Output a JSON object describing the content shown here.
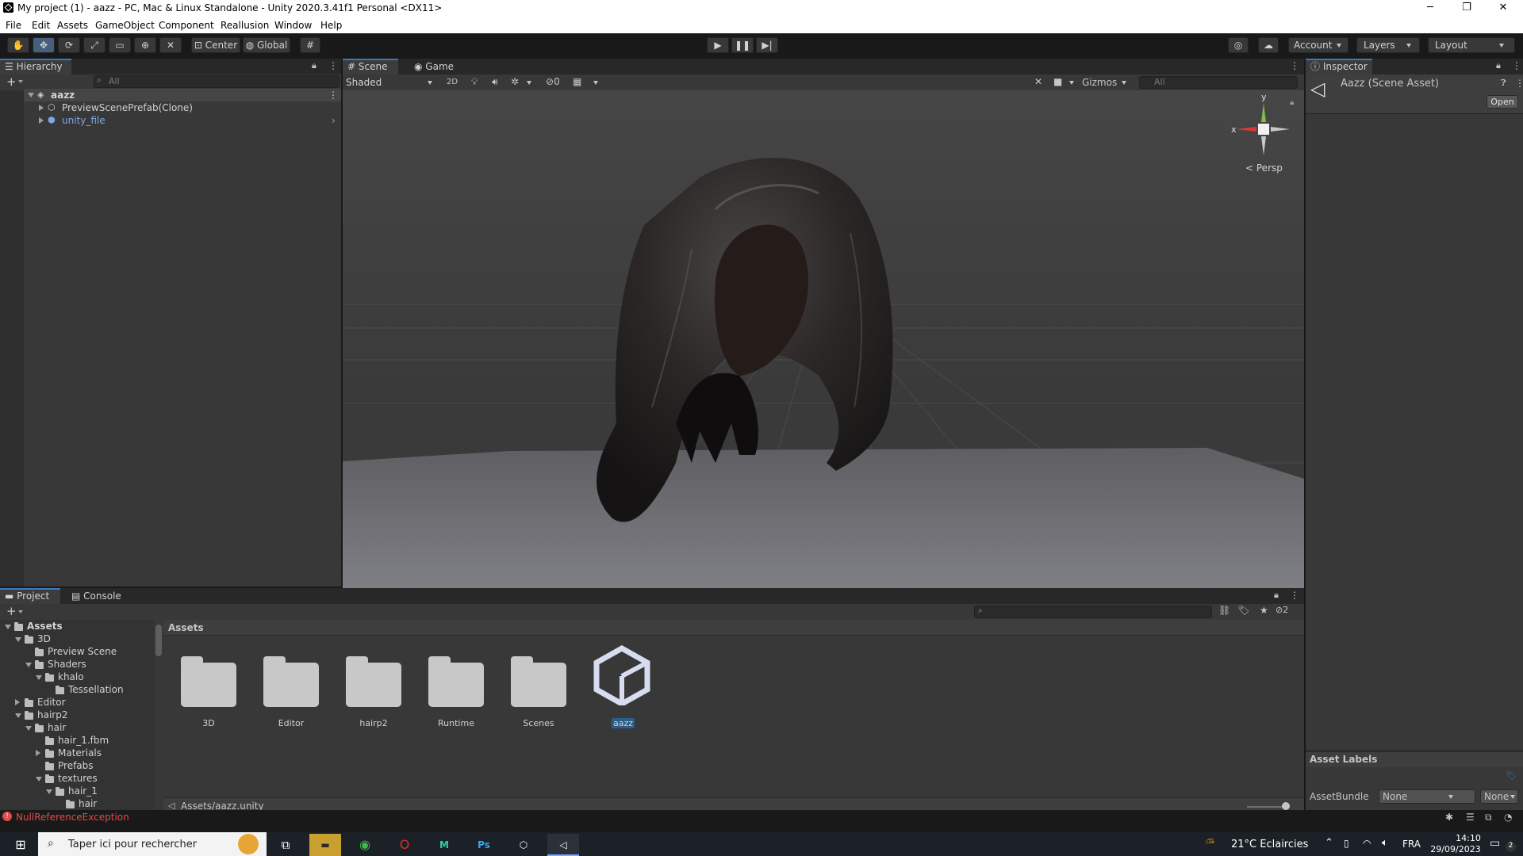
{
  "window": {
    "title": "My project (1) - aazz - PC, Mac & Linux Standalone - Unity 2020.3.41f1 Personal <DX11>",
    "minimize": "─",
    "restore": "❐",
    "close": "✕"
  },
  "menu": [
    "File",
    "Edit",
    "Assets",
    "GameObject",
    "Component",
    "Reallusion",
    "Window",
    "Help"
  ],
  "toolbar": {
    "center_label": "Center",
    "global_label": "Global",
    "account_label": "Account",
    "layers_label": "Layers",
    "layout_label": "Layout"
  },
  "hierarchy": {
    "tab_label": "Hierarchy",
    "search_placeholder": "All",
    "scene_name": "aazz",
    "items": [
      "PreviewScenePrefab(Clone)",
      "unity_file"
    ]
  },
  "scene": {
    "tab_scene": "Scene",
    "tab_game": "Game",
    "shading_mode": "Shaded",
    "mode_2d": "2D",
    "hidden_count": "0",
    "gizmos_label": "Gizmos",
    "search_placeholder": "All",
    "axis_y": "y",
    "axis_x": "x",
    "projection_label": "Persp"
  },
  "inspector": {
    "tab_label": "Inspector",
    "asset_title": "Aazz (Scene Asset)",
    "open_button": "Open",
    "asset_labels_title": "Asset Labels",
    "assetbundle_label": "AssetBundle",
    "assetbundle_value": "None",
    "variant_value": "None"
  },
  "project": {
    "tab_project": "Project",
    "tab_console": "Console",
    "hidden_count": "2",
    "tree": [
      {
        "label": "Assets",
        "depth": 0,
        "expanded": true,
        "bold": true
      },
      {
        "label": "3D",
        "depth": 1,
        "expanded": true
      },
      {
        "label": "Preview Scene",
        "depth": 2,
        "leaf": true
      },
      {
        "label": "Shaders",
        "depth": 2,
        "expanded": true
      },
      {
        "label": "khalo",
        "depth": 3,
        "expanded": true
      },
      {
        "label": "Tessellation",
        "depth": 4,
        "leaf": true
      },
      {
        "label": "Editor",
        "depth": 1,
        "expanded": false
      },
      {
        "label": "hairp2",
        "depth": 1,
        "expanded": true
      },
      {
        "label": "hair",
        "depth": 2,
        "expanded": true
      },
      {
        "label": "hair_1.fbm",
        "depth": 3,
        "leaf": true
      },
      {
        "label": "Materials",
        "depth": 3,
        "expanded": false
      },
      {
        "label": "Prefabs",
        "depth": 3,
        "leaf": true
      },
      {
        "label": "textures",
        "depth": 3,
        "expanded": true
      },
      {
        "label": "hair_1",
        "depth": 4,
        "expanded": true
      },
      {
        "label": "hair",
        "depth": 5,
        "leaf": true
      }
    ],
    "breadcrumb": "Assets",
    "assets": [
      {
        "label": "3D",
        "type": "folder"
      },
      {
        "label": "Editor",
        "type": "folder"
      },
      {
        "label": "hairp2",
        "type": "folder"
      },
      {
        "label": "Runtime",
        "type": "folder"
      },
      {
        "label": "Scenes",
        "type": "folder"
      },
      {
        "label": "aazz",
        "type": "unity-scene"
      }
    ],
    "selected_path": "Assets/aazz.unity"
  },
  "status": {
    "error_text": "NullReferenceException"
  },
  "taskbar": {
    "search_placeholder": "Taper ici pour rechercher",
    "weather": "21°C Eclaircies",
    "language": "FRA",
    "time": "14:10",
    "date": "29/09/2023",
    "notification_count": "2"
  }
}
